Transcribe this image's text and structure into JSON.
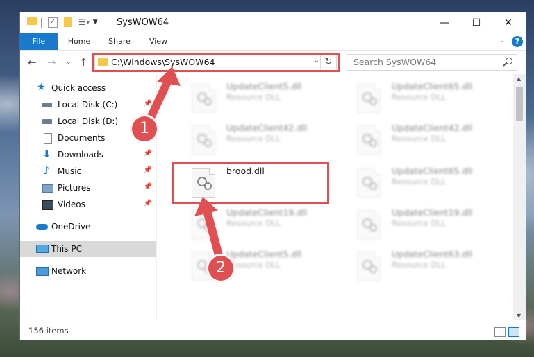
{
  "window": {
    "title": "SysWOW64",
    "minimize": "—",
    "maximize": "☐",
    "close": "✕"
  },
  "ribbon": {
    "tabs": [
      {
        "label": "File"
      },
      {
        "label": "Home"
      },
      {
        "label": "Share"
      },
      {
        "label": "View"
      }
    ],
    "help": "?"
  },
  "address": {
    "path": "C:\\Windows\\SysWOW64",
    "search_placeholder": "Search SysWOW64"
  },
  "nav": {
    "quick_access": "Quick access",
    "items": [
      {
        "label": "Local Disk (C:)",
        "pinned": true
      },
      {
        "label": "Local Disk (D:)",
        "pinned": false
      },
      {
        "label": "Documents",
        "pinned": true
      },
      {
        "label": "Downloads",
        "pinned": true
      },
      {
        "label": "Music",
        "pinned": true
      },
      {
        "label": "Pictures",
        "pinned": true
      },
      {
        "label": "Videos",
        "pinned": true
      }
    ],
    "onedrive": "OneDrive",
    "this_pc": "This PC",
    "network": "Network"
  },
  "files": {
    "left": [
      {
        "name": "UpdateClient5.dll",
        "desc": "Resource DLL",
        "blurred": true
      },
      {
        "name": "UpdateClient42.dll",
        "desc": "Resource DLL",
        "blurred": true
      },
      {
        "name": "brood.dll",
        "desc": "",
        "blurred": false
      },
      {
        "name": "UpdateClient19.dll",
        "desc": "Resource DLL",
        "blurred": true
      },
      {
        "name": "UpdateClient5.dll",
        "desc": "Resource DLL",
        "blurred": true
      }
    ],
    "right": [
      {
        "name": "UpdateClient65.dll",
        "desc": "Resource DLL",
        "blurred": true
      },
      {
        "name": "UpdateClient42.dll",
        "desc": "Resource DLL",
        "blurred": true
      },
      {
        "name": "UpdateClient65.dll",
        "desc": "Resource DLL",
        "blurred": true
      },
      {
        "name": "UpdateClient19.dll",
        "desc": "Resource DLL",
        "blurred": true
      },
      {
        "name": "UpdateClient63.dll",
        "desc": "Resource DLL",
        "blurred": true
      }
    ]
  },
  "status": {
    "count": "156 items"
  },
  "annotations": {
    "step1": "1",
    "step2": "2",
    "color": "#e05052"
  }
}
